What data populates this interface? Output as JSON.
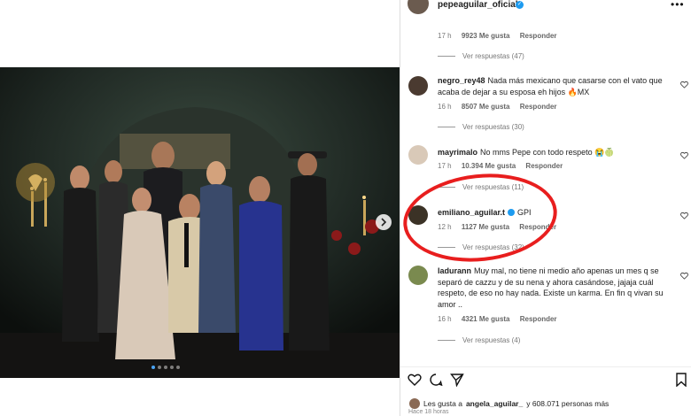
{
  "header": {
    "username": "pepeaguilar_oficial",
    "more_icon": "more-horizontal-icon"
  },
  "top_meta": {
    "time": "17 h",
    "likes": "9923 Me gusta",
    "reply": "Responder"
  },
  "top_replies": "Ver respuestas (47)",
  "comments": [
    {
      "user": "negro_rey48",
      "text": "Nada más mexicano que casarse con el vato que acaba de dejar a su esposa eh hijos 🔥MX",
      "time": "16 h",
      "likes": "8507 Me gusta",
      "reply": "Responder",
      "replies": "Ver respuestas (30)"
    },
    {
      "user": "mayrimalo",
      "text": "No mms Pepe con todo respeto 😭🍈",
      "time": "17 h",
      "likes": "10.394 Me gusta",
      "reply": "Responder",
      "replies": "Ver respuestas (11)"
    },
    {
      "user": "emiliano_aguilar.t",
      "text": "GPI",
      "time": "12 h",
      "likes": "1127 Me gusta",
      "reply": "Responder",
      "replies": "Ver respuestas (32)"
    },
    {
      "user": "ladurann",
      "text": "Muy mal, no tiene ni medio año apenas un mes q se separó de cazzu y de su nena y ahora casándose, jajaja cuál respeto, de eso no hay nada. Existe un karma. En fin q vivan su amor ..",
      "time": "16 h",
      "likes": "4321 Me gusta",
      "reply": "Responder",
      "replies": "Ver respuestas (4)"
    }
  ],
  "footer": {
    "likes_prefix": "Les gusta a",
    "likes_user": "angela_aguilar_",
    "likes_suffix": "y 608.071 personas más",
    "ago": "Hace 18 horas"
  },
  "colors": {
    "accent": "#1d9bf0",
    "highlight": "#e81e1e"
  }
}
